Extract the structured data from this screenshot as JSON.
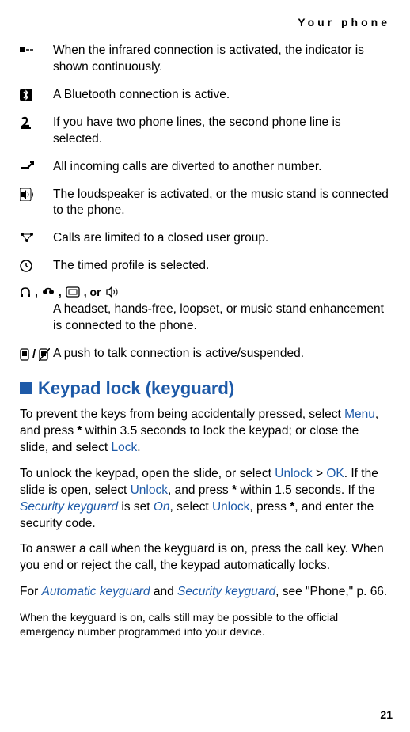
{
  "header": "Your phone",
  "indicators": {
    "infrared": "When the infrared connection is activated, the indicator is shown continuously.",
    "bluetooth": "A Bluetooth connection is active.",
    "line2": "If you have two phone lines, the second phone line is selected.",
    "divert": "All incoming calls are diverted to another number.",
    "loudspeaker": "The loudspeaker is activated, or the music stand is connected to the phone.",
    "cug": "Calls are limited to a closed user group.",
    "timed": "The timed profile is selected.",
    "headset_sep1": ",",
    "headset_sep2": ",",
    "headset_sep3": ", or",
    "headset": "A headset, hands-free, loopset, or music stand enhancement is connected to the phone.",
    "ptt": "A push to talk connection is active/suspended."
  },
  "section": {
    "title": "Keypad lock (keyguard)"
  },
  "para1": {
    "t1": "To prevent the keys from being accidentally pressed, select ",
    "menu": "Menu",
    "t2": ", and press ",
    "star1": "*",
    "t3": " within 3.5 seconds to lock the keypad; or close the slide, and select ",
    "lock": "Lock",
    "t4": "."
  },
  "para2": {
    "t1": "To unlock the keypad, open the slide, or select ",
    "unlock1": "Unlock",
    "t2": " > ",
    "ok": "OK",
    "t3": ". If the slide is open, select ",
    "unlock2": "Unlock",
    "t4": ", and press ",
    "star1": "*",
    "t5": " within 1.5 seconds. If the ",
    "seckey": "Security keyguard",
    "t6": " is set ",
    "on": "On",
    "t7": ", select ",
    "unlock3": "Unlock",
    "t8": ", press ",
    "star2": "*",
    "t9": ", and enter the security code."
  },
  "para3": "To answer a call when the keyguard is on, press the call key. When you end or reject the call, the keypad automatically locks.",
  "para4": {
    "t1": "For ",
    "auto": "Automatic keyguard",
    "t2": " and ",
    "sec": "Security keyguard",
    "t3": ", see \"Phone,\" p. 66."
  },
  "note": "When the keyguard is on, calls still may be possible to the official emergency number programmed into your device.",
  "pagenum": "21"
}
